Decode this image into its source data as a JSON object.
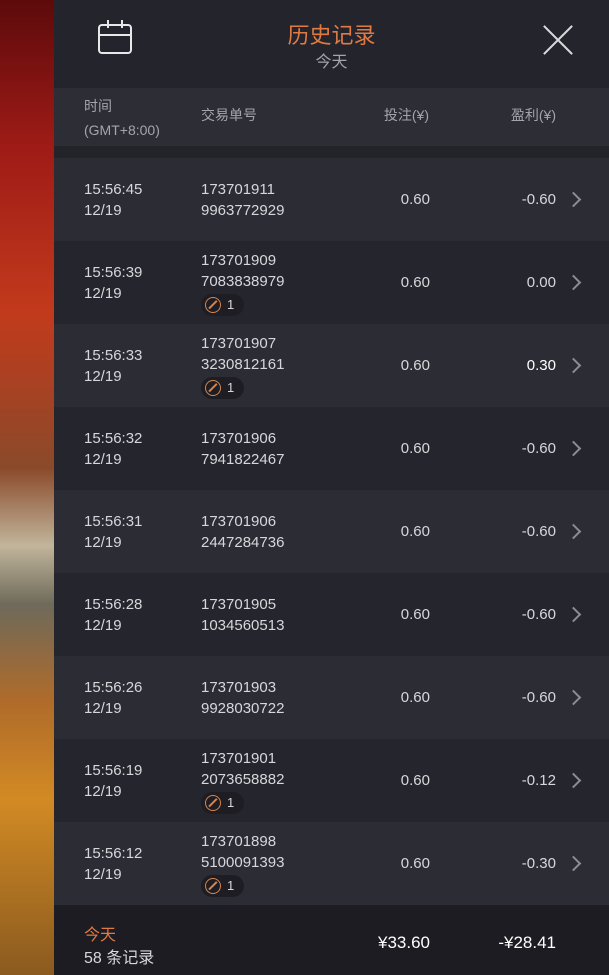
{
  "header": {
    "title": "历史记录",
    "subtitle": "今天",
    "calendar_icon": "calendar-icon",
    "close_icon": "close-icon"
  },
  "columns": {
    "time_line1": "时间",
    "time_line2": "(GMT+8:00)",
    "order": "交易单号",
    "bet": "投注(¥)",
    "profit": "盈利(¥)"
  },
  "rows": [
    {
      "time": "15:56:45",
      "date": "12/19",
      "order1": "173701911",
      "order2": "9963772929",
      "bet": "0.60",
      "profit": "-0.60",
      "badge": ""
    },
    {
      "time": "15:56:39",
      "date": "12/19",
      "order1": "173701909",
      "order2": "7083838979",
      "bet": "0.60",
      "profit": "0.00",
      "badge": "1"
    },
    {
      "time": "15:56:33",
      "date": "12/19",
      "order1": "173701907",
      "order2": "3230812161",
      "bet": "0.60",
      "profit": "0.30",
      "badge": "1"
    },
    {
      "time": "15:56:32",
      "date": "12/19",
      "order1": "173701906",
      "order2": "7941822467",
      "bet": "0.60",
      "profit": "-0.60",
      "badge": ""
    },
    {
      "time": "15:56:31",
      "date": "12/19",
      "order1": "173701906",
      "order2": "2447284736",
      "bet": "0.60",
      "profit": "-0.60",
      "badge": ""
    },
    {
      "time": "15:56:28",
      "date": "12/19",
      "order1": "173701905",
      "order2": "1034560513",
      "bet": "0.60",
      "profit": "-0.60",
      "badge": ""
    },
    {
      "time": "15:56:26",
      "date": "12/19",
      "order1": "173701903",
      "order2": "9928030722",
      "bet": "0.60",
      "profit": "-0.60",
      "badge": ""
    },
    {
      "time": "15:56:19",
      "date": "12/19",
      "order1": "173701901",
      "order2": "2073658882",
      "bet": "0.60",
      "profit": "-0.12",
      "badge": "1"
    },
    {
      "time": "15:56:12",
      "date": "12/19",
      "order1": "173701898",
      "order2": "5100091393",
      "bet": "0.60",
      "profit": "-0.30",
      "badge": "1"
    }
  ],
  "footer": {
    "label": "今天",
    "count": "58 条记录",
    "total_bet": "¥33.60",
    "total_profit": "-¥28.41"
  },
  "colors": {
    "accent": "#e07a43",
    "panel": "#2a2a33"
  }
}
